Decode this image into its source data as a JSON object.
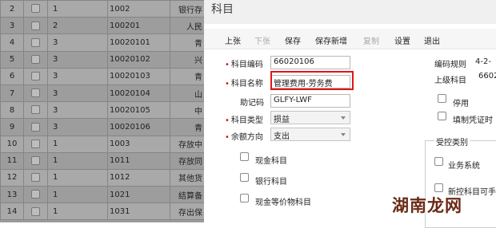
{
  "grid": {
    "rows": [
      {
        "num": "2",
        "level": "1",
        "code": "1002",
        "name": "银行存"
      },
      {
        "num": "3",
        "level": "2",
        "code": "100201",
        "name": "人民"
      },
      {
        "num": "4",
        "level": "3",
        "code": "10020101",
        "name": "青"
      },
      {
        "num": "5",
        "level": "3",
        "code": "10020102",
        "name": "兴"
      },
      {
        "num": "6",
        "level": "3",
        "code": "10020103",
        "name": "青"
      },
      {
        "num": "7",
        "level": "3",
        "code": "10020104",
        "name": "山"
      },
      {
        "num": "8",
        "level": "3",
        "code": "10020105",
        "name": "中"
      },
      {
        "num": "9",
        "level": "3",
        "code": "10020106",
        "name": "青"
      },
      {
        "num": "10",
        "level": "1",
        "code": "1003",
        "name": "存放中"
      },
      {
        "num": "11",
        "level": "1",
        "code": "1011",
        "name": "存放同"
      },
      {
        "num": "12",
        "level": "1",
        "code": "1012",
        "name": "其他货"
      },
      {
        "num": "13",
        "level": "1",
        "code": "1021",
        "name": "结算备"
      },
      {
        "num": "14",
        "level": "1",
        "code": "1031",
        "name": "存出保"
      }
    ]
  },
  "dialog": {
    "title": "科目",
    "toolbar": {
      "up": "上张",
      "down": "下张",
      "save": "保存",
      "save_new": "保存新增",
      "copy": "复制",
      "settings": "设置",
      "exit": "退出"
    },
    "form": {
      "code_label": "科目编码",
      "code_value": "66020106",
      "name_label": "科目名称",
      "name_value": "管理费用-劳务费",
      "mnemonic_label": "助记码",
      "mnemonic_value": "GLFY-LWF",
      "type_label": "科目类型",
      "type_value": "损益",
      "direction_label": "余额方向",
      "direction_value": "支出",
      "cash_label": "现金科目",
      "bank_label": "银行科目",
      "cash_eq_label": "现金等价物科目"
    },
    "right": {
      "coding_rule_label": "编码规则",
      "coding_rule_value": "4-2-",
      "parent_label": "上级科目",
      "parent_value": "6602",
      "disabled_label": "停用",
      "voucher_label": "填制凭证时",
      "control_group_title": "受控类别",
      "business_system_label": "业务系统",
      "unknown_label": "新控科目可手"
    }
  },
  "watermark": "湖南龙网"
}
